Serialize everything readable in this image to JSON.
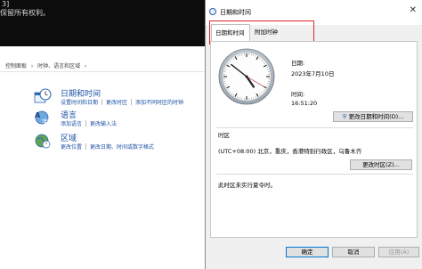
{
  "console": {
    "line1": "3]",
    "line2": "保留所有权利。"
  },
  "control_panel": {
    "breadcrumb": [
      "控制面板",
      "时钟、语言和区域"
    ],
    "categories": [
      {
        "title": "日期和时间",
        "links": [
          "设置时间和日期",
          "更改时区",
          "添加不同时区的时钟"
        ],
        "icon": "clock-calendar-icon"
      },
      {
        "title": "语言",
        "links": [
          "添加语言",
          "更改输入法"
        ],
        "icon": "language-icon"
      },
      {
        "title": "区域",
        "links": [
          "更改位置",
          "更改日期、时间或数字格式"
        ],
        "icon": "globe-clock-icon"
      }
    ]
  },
  "dialog": {
    "title": "日期和时间",
    "tabs": [
      "日期和时间",
      "附加时钟"
    ],
    "date_label": "日期:",
    "date_value": "2023年7月10日",
    "time_label": "时间:",
    "time_value": "16:51:20",
    "change_datetime_button": "更改日期和时间(D)...",
    "timezone_section": "时区",
    "timezone_value": "(UTC+08:00) 北京，重庆，香港特别行政区，乌鲁木齐",
    "change_timezone_button": "更改时区(Z)...",
    "dst_note": "此时区未实行夏令时。",
    "ok_button": "确定",
    "cancel_button": "取消",
    "apply_button": "应用(A)",
    "clock": {
      "hours": 16,
      "minutes": 51,
      "seconds": 20
    },
    "highlight_color": "#d9262b"
  }
}
